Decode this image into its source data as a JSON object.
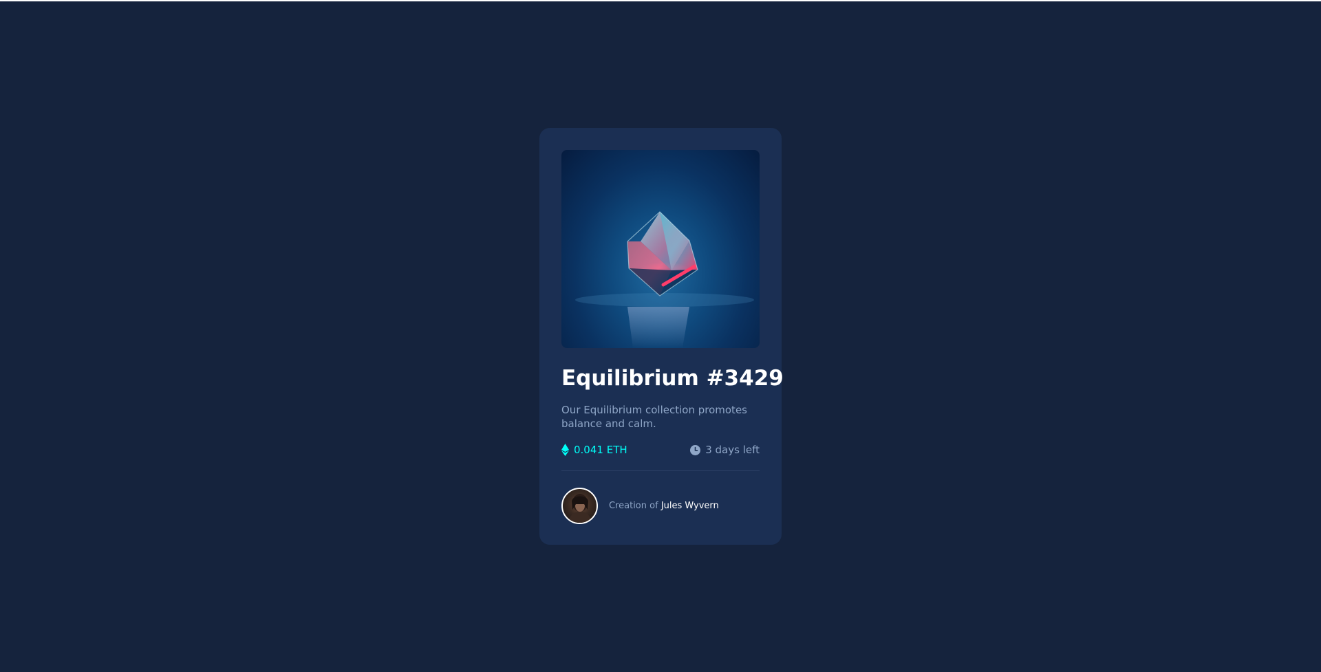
{
  "nft_card": {
    "title": "Equilibrium #3429",
    "description": "Our Equilibrium collection promotes balance and calm.",
    "price": "0.041 ETH",
    "time_left": "3 days left",
    "creator_prefix": "Creation of",
    "creator_name": "Jules Wyvern"
  },
  "icons": {
    "price_icon": "ethereum-icon",
    "time_icon": "clock-icon"
  },
  "colors": {
    "page_background": "#15233d",
    "card_background": "#1b2f53",
    "accent_cyan": "#00fff8",
    "muted_text": "#8fa6c7",
    "heading_text": "#ffffff",
    "divider": "#2e4268"
  }
}
